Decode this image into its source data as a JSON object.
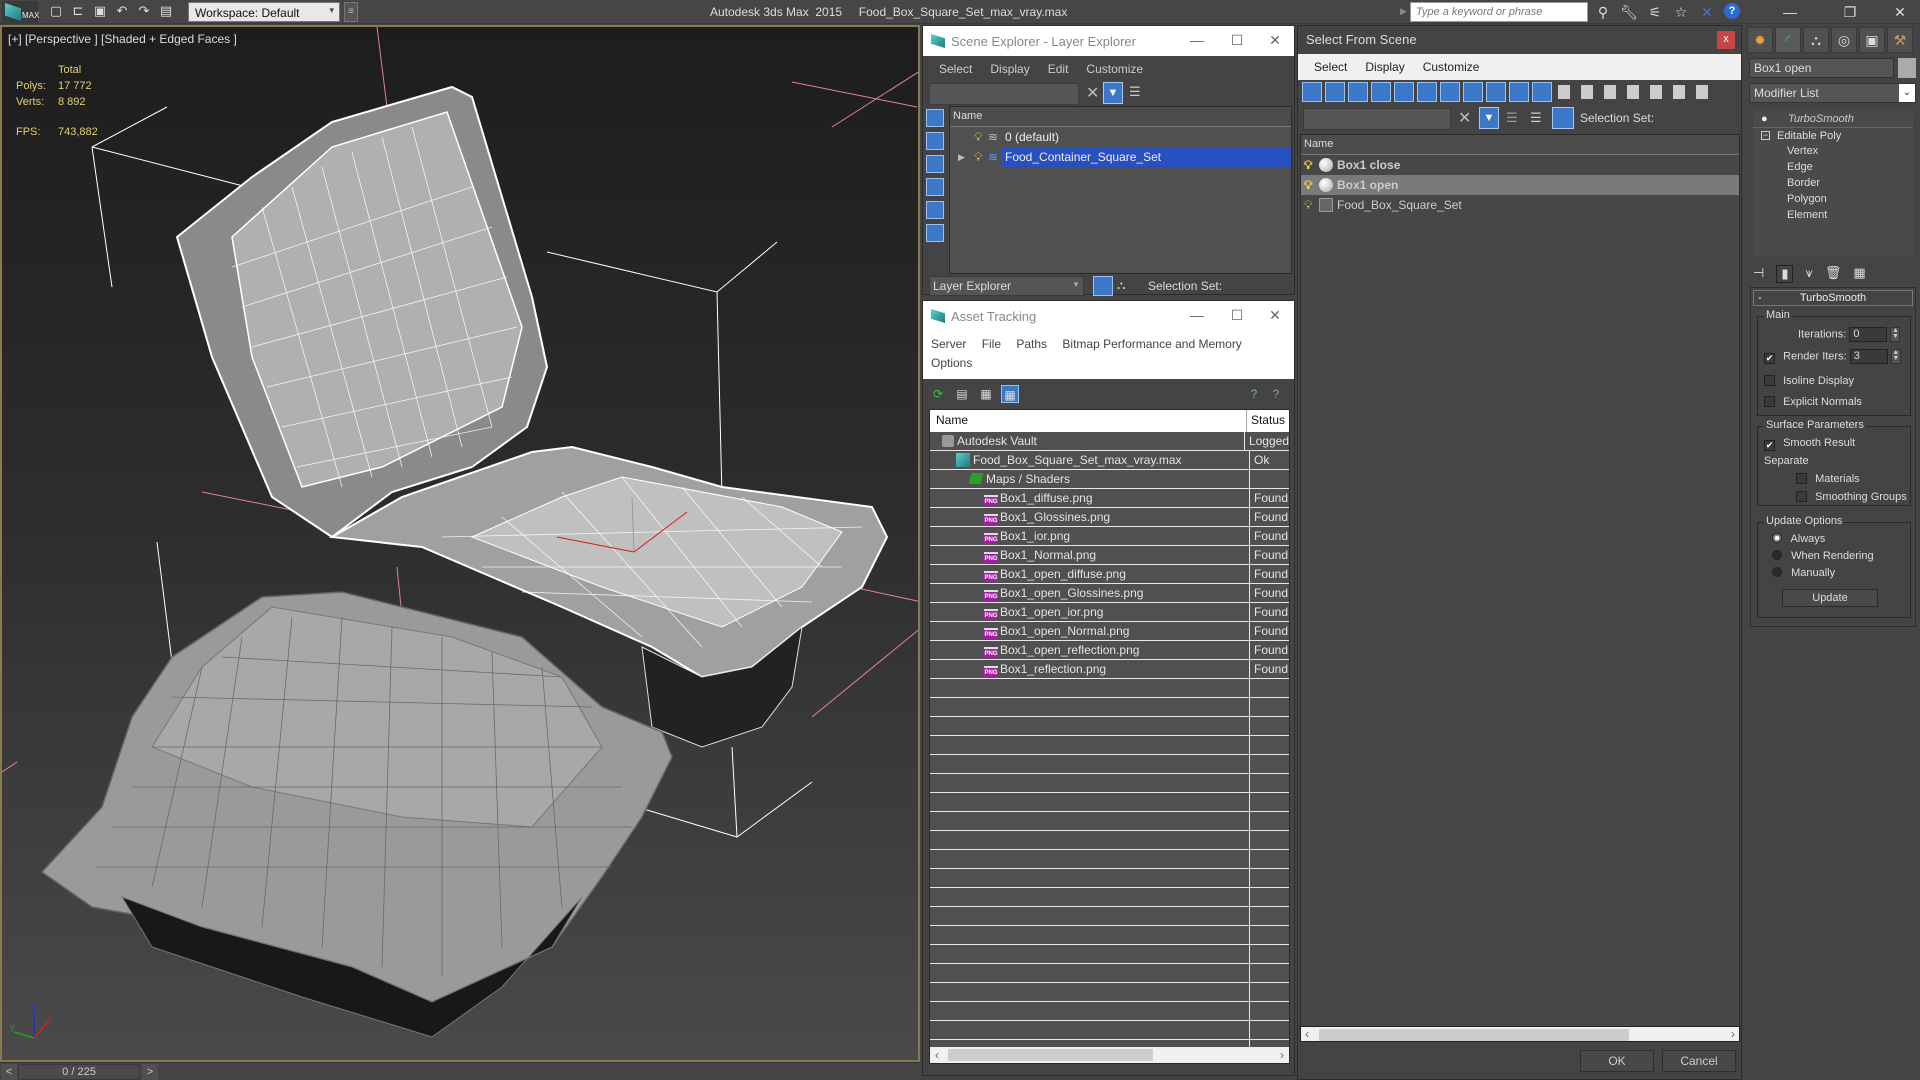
{
  "titlebar": {
    "app_title": "Autodesk 3ds Max  2015",
    "file_name": "Food_Box_Square_Set_max_vray.max",
    "workspace": "Workspace: Default",
    "search_placeholder": "Type a keyword or phrase",
    "logo_text": "MAX",
    "icons": [
      "new-file-icon",
      "open-file-icon",
      "save-icon",
      "undo-icon",
      "redo-icon",
      "project-icon"
    ],
    "right_icons": [
      "binoculars-icon",
      "wrench-icon",
      "satellite-icon",
      "star-icon",
      "x-icon",
      "help-icon"
    ],
    "help_label": "?"
  },
  "viewport": {
    "label": "[+] [Perspective ] [Shaded + Edged Faces ]",
    "stats": {
      "header": "Total",
      "polys_label": "Polys:",
      "polys": "17 772",
      "verts_label": "Verts:",
      "verts": "8 892",
      "fps_label": "FPS:",
      "fps": "743,882"
    },
    "axis": {
      "x": "x",
      "y": "y",
      "z": "z"
    }
  },
  "timeline": {
    "prev": "<",
    "next": ">",
    "frame": "0 / 225"
  },
  "scene_explorer": {
    "title": "Scene Explorer - Layer Explorer",
    "menus": [
      "Select",
      "Display",
      "Edit",
      "Customize"
    ],
    "column_name": "Name",
    "layers": [
      {
        "name": "0 (default)",
        "selected": false,
        "expandable": false
      },
      {
        "name": "Food_Container_Square_Set",
        "selected": true,
        "expandable": true
      }
    ],
    "mode": "Layer Explorer",
    "selection_set_label": "Selection Set:"
  },
  "asset_tracking": {
    "title": "Asset Tracking",
    "menus": [
      "Server",
      "File",
      "Paths",
      "Bitmap Performance and Memory",
      "Options"
    ],
    "columns": [
      "Name",
      "Status"
    ],
    "rows": [
      {
        "name": "Autodesk Vault",
        "status": "Logged",
        "type": "vault",
        "indent": 1
      },
      {
        "name": "Food_Box_Square_Set_max_vray.max",
        "status": "Ok",
        "type": "max",
        "indent": 2
      },
      {
        "name": "Maps / Shaders",
        "status": "",
        "type": "maps",
        "indent": 3
      },
      {
        "name": "Box1_diffuse.png",
        "status": "Found",
        "type": "png",
        "indent": 4
      },
      {
        "name": "Box1_Glossines.png",
        "status": "Found",
        "type": "png",
        "indent": 4
      },
      {
        "name": "Box1_ior.png",
        "status": "Found",
        "type": "png",
        "indent": 4
      },
      {
        "name": "Box1_Normal.png",
        "status": "Found",
        "type": "png",
        "indent": 4
      },
      {
        "name": "Box1_open_diffuse.png",
        "status": "Found",
        "type": "png",
        "indent": 4
      },
      {
        "name": "Box1_open_Glossines.png",
        "status": "Found",
        "type": "png",
        "indent": 4
      },
      {
        "name": "Box1_open_ior.png",
        "status": "Found",
        "type": "png",
        "indent": 4
      },
      {
        "name": "Box1_open_Normal.png",
        "status": "Found",
        "type": "png",
        "indent": 4
      },
      {
        "name": "Box1_open_reflection.png",
        "status": "Found",
        "type": "png",
        "indent": 4
      },
      {
        "name": "Box1_reflection.png",
        "status": "Found",
        "type": "png",
        "indent": 4
      }
    ],
    "png_badge": "PNG"
  },
  "select_from_scene": {
    "title": "Select From Scene",
    "close_label": "x",
    "menus": [
      "Select",
      "Display",
      "Customize"
    ],
    "column_name": "Name",
    "selection_set_label": "Selection Set:",
    "objects": [
      {
        "name": "Box1 close",
        "bold": true,
        "selected": false,
        "type": "geometry"
      },
      {
        "name": "Box1 open",
        "bold": true,
        "selected": true,
        "type": "geometry"
      },
      {
        "name": "Food_Box_Square_Set",
        "bold": false,
        "selected": false,
        "type": "group"
      }
    ],
    "ok_label": "OK",
    "cancel_label": "Cancel"
  },
  "command_panel": {
    "object_name": "Box1 open",
    "modifier_list": "Modifier List",
    "stack": {
      "top_modifier": "TurboSmooth",
      "base": "Editable Poly",
      "sub_objects": [
        "Vertex",
        "Edge",
        "Border",
        "Polygon",
        "Element"
      ]
    },
    "turbosmooth": {
      "title": "TurboSmooth",
      "collapse": "-",
      "main_label": "Main",
      "iterations_label": "Iterations:",
      "iterations": "0",
      "render_iters_label": "Render Iters:",
      "render_iters": "3",
      "render_iters_checked": true,
      "isoline_label": "Isoline Display",
      "isoline_checked": false,
      "explicit_normals_label": "Explicit Normals",
      "explicit_normals_checked": false,
      "surface_label": "Surface Parameters",
      "smooth_result_label": "Smooth Result",
      "smooth_result_checked": true,
      "separate_label": "Separate",
      "materials_label": "Materials",
      "smoothing_groups_label": "Smoothing Groups",
      "update_options_label": "Update Options",
      "update_options": [
        "Always",
        "When Rendering",
        "Manually"
      ],
      "update_selected": "Always",
      "update_button": "Update"
    }
  }
}
